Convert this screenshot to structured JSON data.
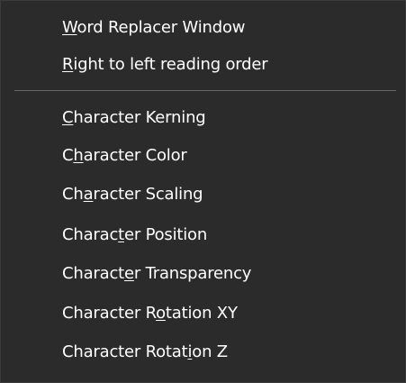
{
  "colors": {
    "background": "#2b2b2b",
    "text": "#ffffff",
    "separator": "#6a6a6a",
    "border": "#3c3c3c"
  },
  "menu": {
    "items": [
      {
        "label": "Word Replacer Window",
        "accel": 0
      },
      {
        "label": "Right to left reading order",
        "accel": 0
      },
      {
        "separator": true
      },
      {
        "label": "Character Kerning",
        "accel": 0
      },
      {
        "label": "Character Color",
        "accel": 1
      },
      {
        "label": "Character Scaling",
        "accel": 2
      },
      {
        "label": "Character Position",
        "accel": 6
      },
      {
        "label": "Character Transparency",
        "accel": 7
      },
      {
        "label": "Character Rotation XY",
        "accel": 11
      },
      {
        "label": "Character Rotation Z",
        "accel": 15
      }
    ]
  }
}
